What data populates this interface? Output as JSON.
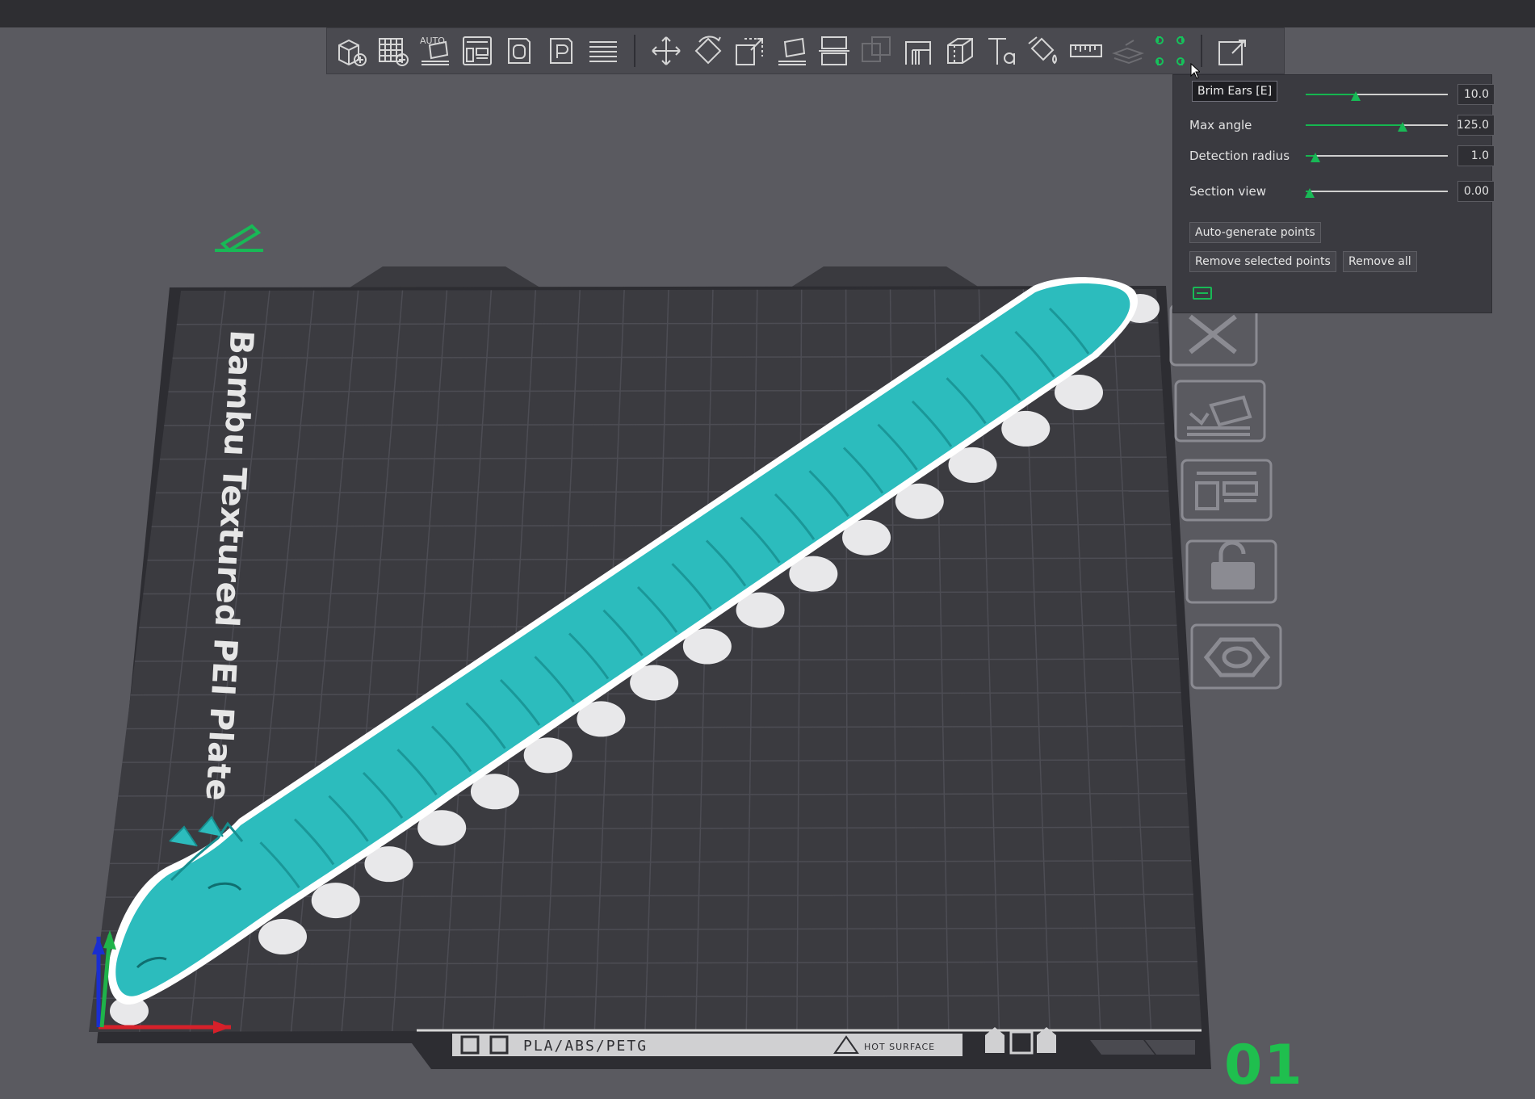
{
  "toolbar": {
    "buttons": [
      {
        "name": "add-object",
        "icon": "cube-plus-icon"
      },
      {
        "name": "add-plate",
        "icon": "grid-plus-icon"
      },
      {
        "name": "auto-orient",
        "icon": "auto-orient-icon",
        "label": "AUTO"
      },
      {
        "name": "arrange",
        "icon": "arrange-icon"
      },
      {
        "name": "split-objects",
        "icon": "split-objects-icon"
      },
      {
        "name": "split-parts",
        "icon": "split-parts-icon"
      },
      {
        "name": "layers",
        "icon": "layers-icon"
      },
      {
        "name": "move",
        "icon": "move-icon"
      },
      {
        "name": "rotate",
        "icon": "rotate-icon"
      },
      {
        "name": "scale",
        "icon": "scale-icon"
      },
      {
        "name": "lay-on-face",
        "icon": "lay-on-face-icon"
      },
      {
        "name": "cut",
        "icon": "cut-icon"
      },
      {
        "name": "boolean",
        "icon": "boolean-icon"
      },
      {
        "name": "support-paint",
        "icon": "support-paint-icon"
      },
      {
        "name": "seam-paint",
        "icon": "seam-paint-icon"
      },
      {
        "name": "text",
        "icon": "text-icon"
      },
      {
        "name": "color-paint",
        "icon": "paint-bucket-icon"
      },
      {
        "name": "measure",
        "icon": "ruler-icon"
      },
      {
        "name": "assembly",
        "icon": "assembly-icon"
      },
      {
        "name": "brim-ears",
        "icon": "brim-ears-icon"
      },
      {
        "name": "assemble-view",
        "icon": "assemble-view-icon"
      }
    ]
  },
  "tooltip": {
    "text": "Brim Ears [E]"
  },
  "panel": {
    "rows": [
      {
        "label": "",
        "value": "10.0",
        "fraction": 0.35
      },
      {
        "label": "Max angle",
        "value": "125.0",
        "fraction": 0.68
      },
      {
        "label": "Detection radius",
        "value": "1.0",
        "fraction": 0.07
      },
      {
        "label": "Section view",
        "value": "0.00",
        "fraction": 0.03
      }
    ],
    "buttons": {
      "auto_generate": "Auto-generate points",
      "remove_selected": "Remove selected points",
      "remove_all": "Remove all"
    }
  },
  "plate": {
    "name": "Bambu Textured PEI Plate",
    "material_label": "PLA/ABS/PETG",
    "hot_surface": "HOT SURFACE",
    "number": "01"
  },
  "colors": {
    "model": "#2fbfbf",
    "accent": "#18b956",
    "plate": "#3a3a3f",
    "background": "#5a5a60"
  },
  "side_icons": [
    "close-icon",
    "auto-orient-icon",
    "arrange-icon",
    "lock-icon",
    "settings-hexagon-icon"
  ]
}
